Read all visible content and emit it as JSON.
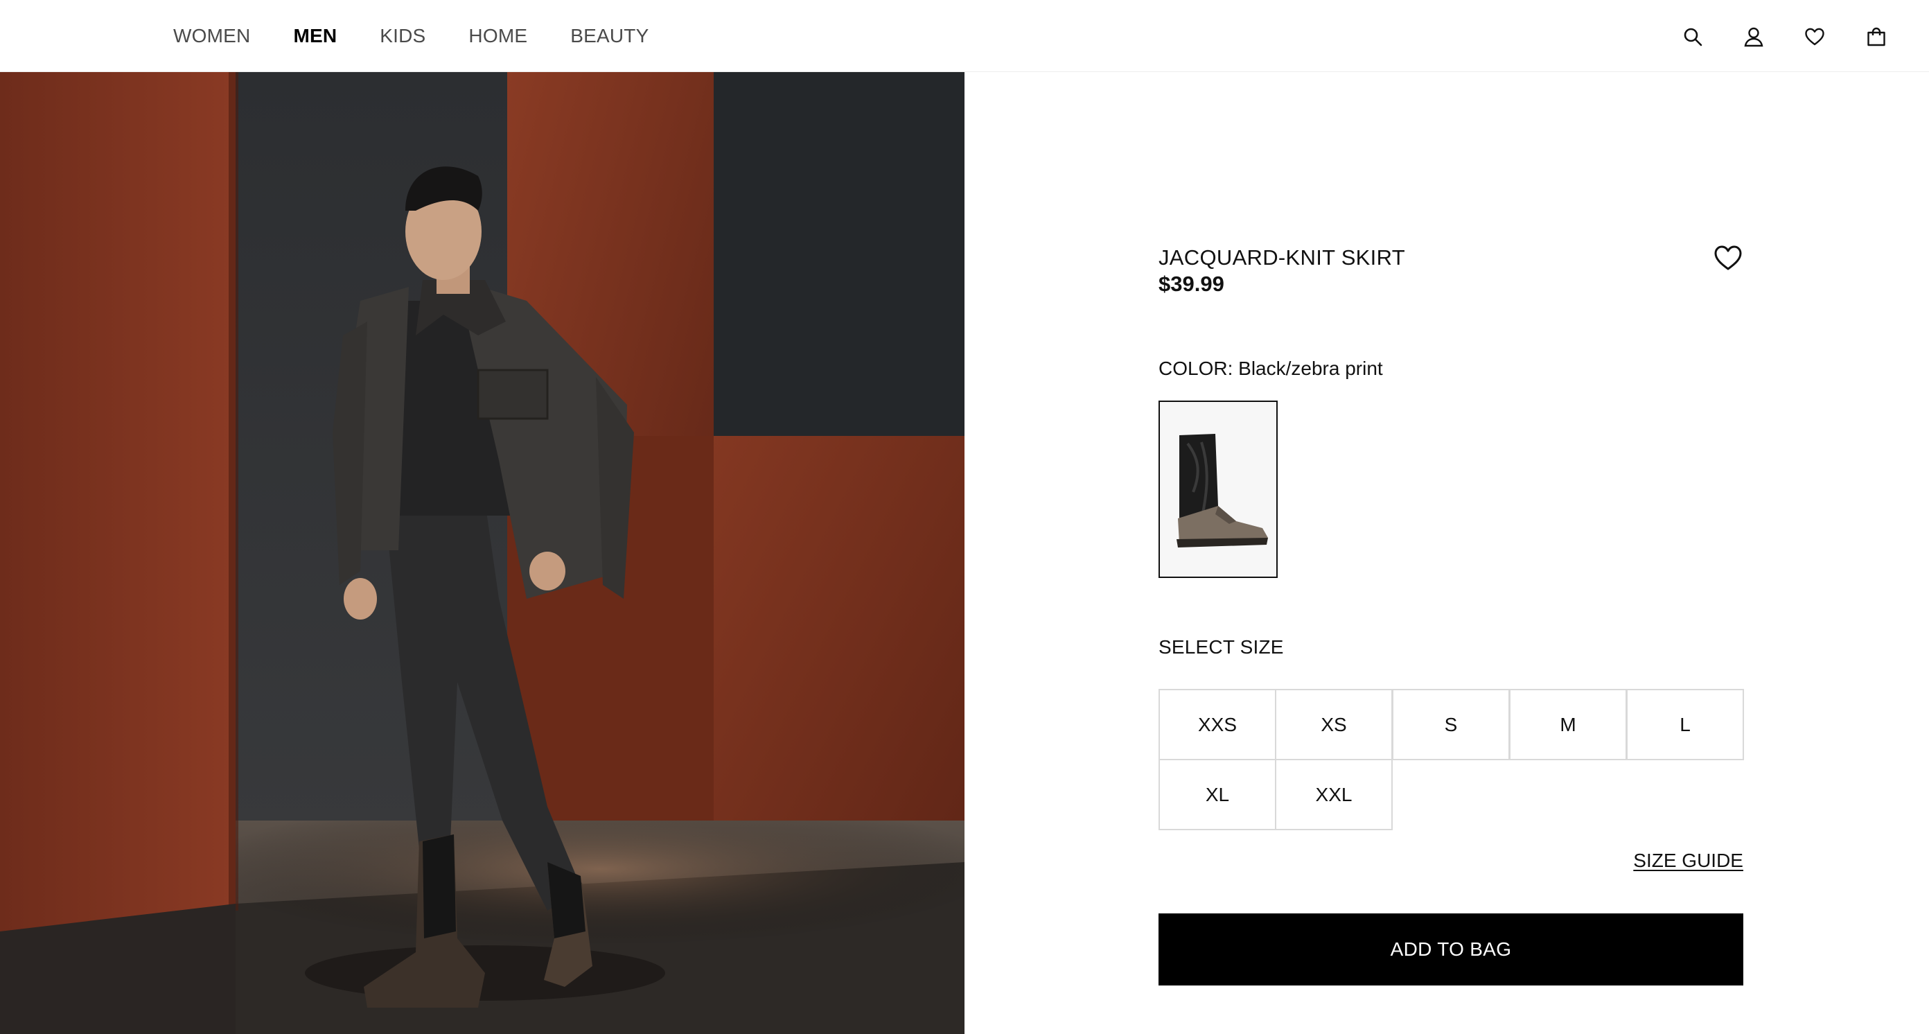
{
  "nav": {
    "items": [
      {
        "label": "WOMEN",
        "active": false
      },
      {
        "label": "MEN",
        "active": true
      },
      {
        "label": "KIDS",
        "active": false
      },
      {
        "label": "HOME",
        "active": false
      },
      {
        "label": "BEAUTY",
        "active": false
      }
    ]
  },
  "header_icons": [
    "search-icon",
    "account-icon",
    "heart-icon",
    "bag-icon"
  ],
  "product": {
    "title": "JACQUARD-KNIT SKIRT",
    "price": "$39.99",
    "color_label": "COLOR:",
    "color_value": "Black/zebra print",
    "select_size_label": "SELECT SIZE",
    "sizes": [
      "XXS",
      "XS",
      "S",
      "M",
      "L",
      "XL",
      "XXL"
    ],
    "size_guide_label": "SIZE GUIDE",
    "add_to_bag_label": "ADD TO BAG"
  },
  "colors": {
    "accent": "#000000",
    "border": "#d9d9d9",
    "hero_wall": "#7a3320"
  }
}
